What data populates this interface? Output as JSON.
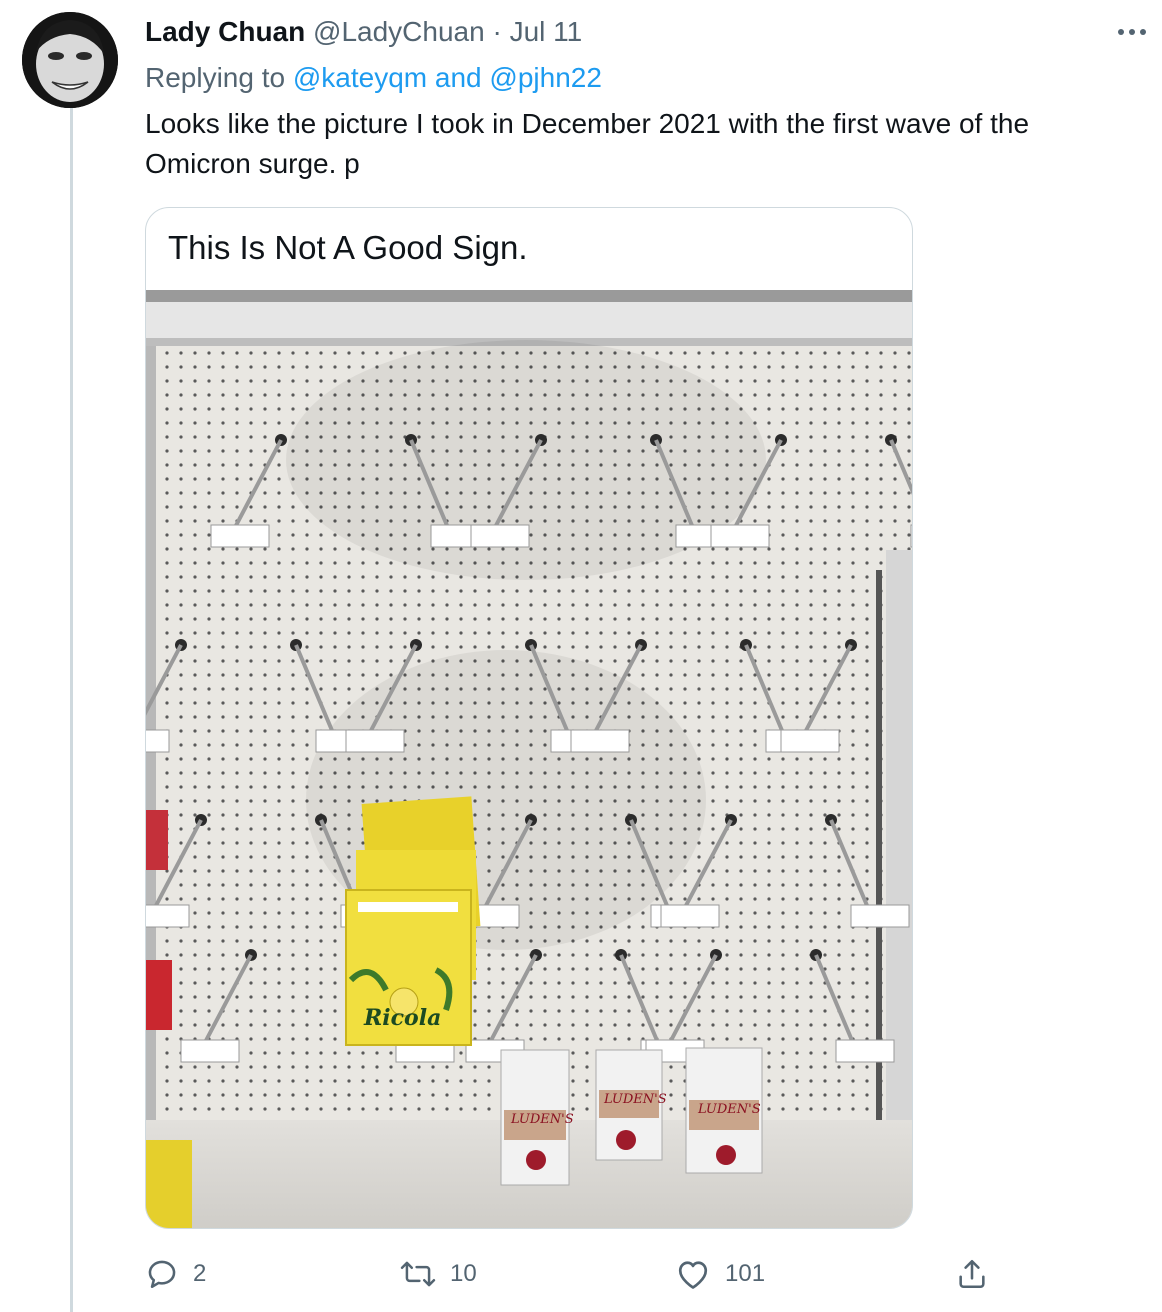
{
  "tweet": {
    "author_name": "Lady Chuan",
    "author_handle": "@LadyChuan",
    "separator": "·",
    "date": "Jul 11",
    "replying_prefix": "Replying to",
    "replying_mention_1": "@kateyqm",
    "replying_and": "and",
    "replying_mention_2": "@pjhn22",
    "text": "Looks like the picture I took in December 2021 with the first wave of the Omicron surge. p"
  },
  "media_card": {
    "title": "This Is Not A Good Sign.",
    "product_label": "Ricola",
    "product_label_2": "LUDEN'S"
  },
  "actions": {
    "reply_count": "2",
    "retweet_count": "10",
    "like_count": "101"
  },
  "icons": {
    "avatar": "avatar-photo",
    "more": "more-icon",
    "reply": "reply-icon",
    "retweet": "retweet-icon",
    "like": "heart-icon",
    "share": "share-icon"
  },
  "colors": {
    "link": "#1d9bf0",
    "secondary_text": "#536471",
    "primary_text": "#0f1419",
    "border": "#cfd9de"
  }
}
